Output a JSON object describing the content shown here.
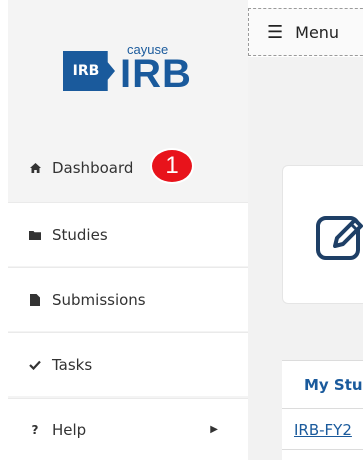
{
  "logo": {
    "badge_text": "IRB",
    "small_text": "cayuse",
    "big_text": "IRB",
    "color": "#1a5a9c"
  },
  "sidebar": {
    "items": [
      {
        "label": "Dashboard",
        "icon": "home-icon"
      },
      {
        "label": "Studies",
        "icon": "folder-icon"
      },
      {
        "label": "Submissions",
        "icon": "file-icon"
      },
      {
        "label": "Tasks",
        "icon": "check-icon"
      },
      {
        "label": "Help",
        "icon": "question-icon"
      }
    ]
  },
  "callout": {
    "number": "1",
    "color": "#e8131b"
  },
  "topbar": {
    "menu_label": "Menu",
    "menu_icon": "hamburger-icon"
  },
  "main": {
    "card_icon": "edit-icon",
    "panel_title": "My Stu",
    "panel_link": "IRB-FY2"
  }
}
